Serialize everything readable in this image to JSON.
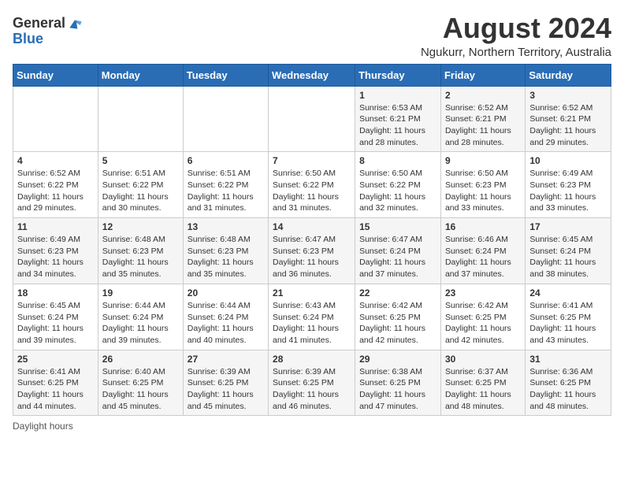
{
  "header": {
    "logo_general": "General",
    "logo_blue": "Blue",
    "main_title": "August 2024",
    "subtitle": "Ngukurr, Northern Territory, Australia"
  },
  "calendar": {
    "days_of_week": [
      "Sunday",
      "Monday",
      "Tuesday",
      "Wednesday",
      "Thursday",
      "Friday",
      "Saturday"
    ],
    "weeks": [
      [
        {
          "day": "",
          "info": ""
        },
        {
          "day": "",
          "info": ""
        },
        {
          "day": "",
          "info": ""
        },
        {
          "day": "",
          "info": ""
        },
        {
          "day": "1",
          "info": "Sunrise: 6:53 AM\nSunset: 6:21 PM\nDaylight: 11 hours and 28 minutes."
        },
        {
          "day": "2",
          "info": "Sunrise: 6:52 AM\nSunset: 6:21 PM\nDaylight: 11 hours and 28 minutes."
        },
        {
          "day": "3",
          "info": "Sunrise: 6:52 AM\nSunset: 6:21 PM\nDaylight: 11 hours and 29 minutes."
        }
      ],
      [
        {
          "day": "4",
          "info": "Sunrise: 6:52 AM\nSunset: 6:22 PM\nDaylight: 11 hours and 29 minutes."
        },
        {
          "day": "5",
          "info": "Sunrise: 6:51 AM\nSunset: 6:22 PM\nDaylight: 11 hours and 30 minutes."
        },
        {
          "day": "6",
          "info": "Sunrise: 6:51 AM\nSunset: 6:22 PM\nDaylight: 11 hours and 31 minutes."
        },
        {
          "day": "7",
          "info": "Sunrise: 6:50 AM\nSunset: 6:22 PM\nDaylight: 11 hours and 31 minutes."
        },
        {
          "day": "8",
          "info": "Sunrise: 6:50 AM\nSunset: 6:22 PM\nDaylight: 11 hours and 32 minutes."
        },
        {
          "day": "9",
          "info": "Sunrise: 6:50 AM\nSunset: 6:23 PM\nDaylight: 11 hours and 33 minutes."
        },
        {
          "day": "10",
          "info": "Sunrise: 6:49 AM\nSunset: 6:23 PM\nDaylight: 11 hours and 33 minutes."
        }
      ],
      [
        {
          "day": "11",
          "info": "Sunrise: 6:49 AM\nSunset: 6:23 PM\nDaylight: 11 hours and 34 minutes."
        },
        {
          "day": "12",
          "info": "Sunrise: 6:48 AM\nSunset: 6:23 PM\nDaylight: 11 hours and 35 minutes."
        },
        {
          "day": "13",
          "info": "Sunrise: 6:48 AM\nSunset: 6:23 PM\nDaylight: 11 hours and 35 minutes."
        },
        {
          "day": "14",
          "info": "Sunrise: 6:47 AM\nSunset: 6:23 PM\nDaylight: 11 hours and 36 minutes."
        },
        {
          "day": "15",
          "info": "Sunrise: 6:47 AM\nSunset: 6:24 PM\nDaylight: 11 hours and 37 minutes."
        },
        {
          "day": "16",
          "info": "Sunrise: 6:46 AM\nSunset: 6:24 PM\nDaylight: 11 hours and 37 minutes."
        },
        {
          "day": "17",
          "info": "Sunrise: 6:45 AM\nSunset: 6:24 PM\nDaylight: 11 hours and 38 minutes."
        }
      ],
      [
        {
          "day": "18",
          "info": "Sunrise: 6:45 AM\nSunset: 6:24 PM\nDaylight: 11 hours and 39 minutes."
        },
        {
          "day": "19",
          "info": "Sunrise: 6:44 AM\nSunset: 6:24 PM\nDaylight: 11 hours and 39 minutes."
        },
        {
          "day": "20",
          "info": "Sunrise: 6:44 AM\nSunset: 6:24 PM\nDaylight: 11 hours and 40 minutes."
        },
        {
          "day": "21",
          "info": "Sunrise: 6:43 AM\nSunset: 6:24 PM\nDaylight: 11 hours and 41 minutes."
        },
        {
          "day": "22",
          "info": "Sunrise: 6:42 AM\nSunset: 6:25 PM\nDaylight: 11 hours and 42 minutes."
        },
        {
          "day": "23",
          "info": "Sunrise: 6:42 AM\nSunset: 6:25 PM\nDaylight: 11 hours and 42 minutes."
        },
        {
          "day": "24",
          "info": "Sunrise: 6:41 AM\nSunset: 6:25 PM\nDaylight: 11 hours and 43 minutes."
        }
      ],
      [
        {
          "day": "25",
          "info": "Sunrise: 6:41 AM\nSunset: 6:25 PM\nDaylight: 11 hours and 44 minutes."
        },
        {
          "day": "26",
          "info": "Sunrise: 6:40 AM\nSunset: 6:25 PM\nDaylight: 11 hours and 45 minutes."
        },
        {
          "day": "27",
          "info": "Sunrise: 6:39 AM\nSunset: 6:25 PM\nDaylight: 11 hours and 45 minutes."
        },
        {
          "day": "28",
          "info": "Sunrise: 6:39 AM\nSunset: 6:25 PM\nDaylight: 11 hours and 46 minutes."
        },
        {
          "day": "29",
          "info": "Sunrise: 6:38 AM\nSunset: 6:25 PM\nDaylight: 11 hours and 47 minutes."
        },
        {
          "day": "30",
          "info": "Sunrise: 6:37 AM\nSunset: 6:25 PM\nDaylight: 11 hours and 48 minutes."
        },
        {
          "day": "31",
          "info": "Sunrise: 6:36 AM\nSunset: 6:25 PM\nDaylight: 11 hours and 48 minutes."
        }
      ]
    ]
  },
  "footer": {
    "note": "Daylight hours"
  }
}
